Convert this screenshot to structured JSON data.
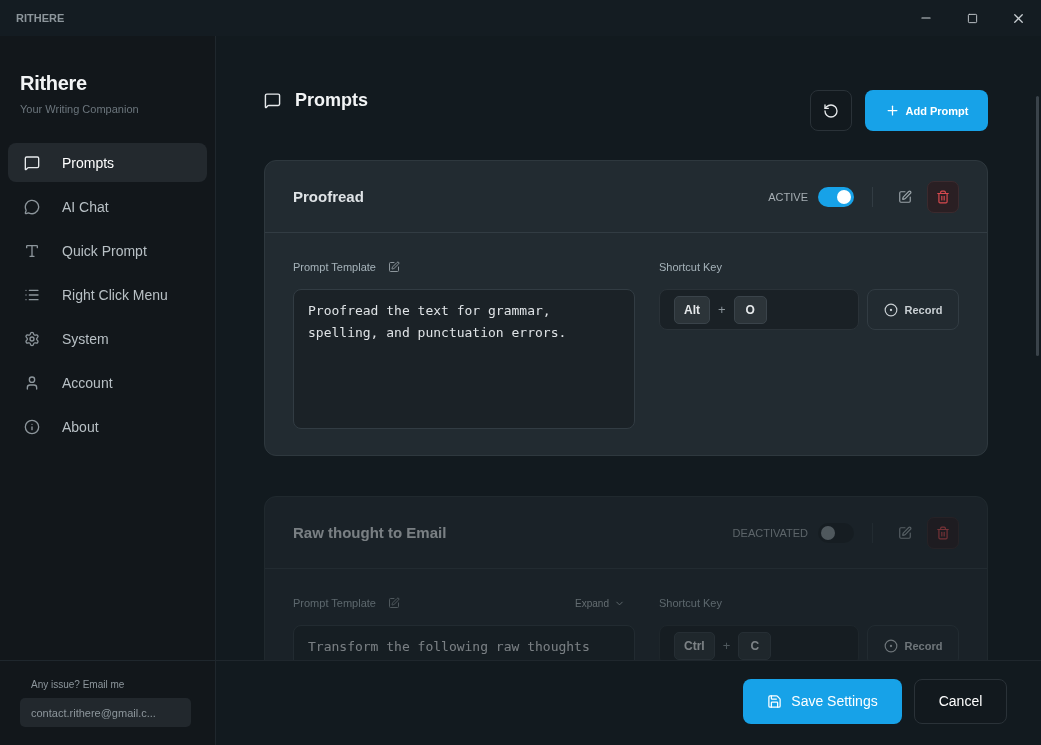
{
  "window": {
    "title": "RITHERE"
  },
  "sidebar": {
    "brand": "Rithere",
    "tagline": "Your Writing Companion",
    "items": [
      {
        "label": "Prompts",
        "selected": true
      },
      {
        "label": "AI Chat",
        "selected": false
      },
      {
        "label": "Quick Prompt",
        "selected": false
      },
      {
        "label": "Right Click Menu",
        "selected": false
      },
      {
        "label": "System",
        "selected": false
      },
      {
        "label": "Account",
        "selected": false
      },
      {
        "label": "About",
        "selected": false
      }
    ],
    "support_label": "Any issue? Email me",
    "support_email": "contact.rithere@gmail.c..."
  },
  "page": {
    "title": "Prompts",
    "add_button": "Add Prompt"
  },
  "prompts": [
    {
      "title": "Proofread",
      "active": true,
      "status": "ACTIVE",
      "template_label": "Prompt Template",
      "template": "Proofread the text for grammar, spelling, and punctuation errors.",
      "shortcut_label": "Shortcut Key",
      "keys": [
        "Alt",
        "O"
      ],
      "key_separator": "+",
      "record_label": "Record"
    },
    {
      "title": "Raw thought to Email",
      "active": false,
      "status": "DEACTIVATED",
      "template_label": "Prompt Template",
      "expand_label": "Expand",
      "template": "Transform the following raw thoughts",
      "shortcut_label": "Shortcut Key",
      "keys": [
        "Ctrl",
        "C"
      ],
      "key_separator": "+",
      "record_label": "Record"
    }
  ],
  "footer": {
    "save": "Save Settings",
    "cancel": "Cancel"
  }
}
